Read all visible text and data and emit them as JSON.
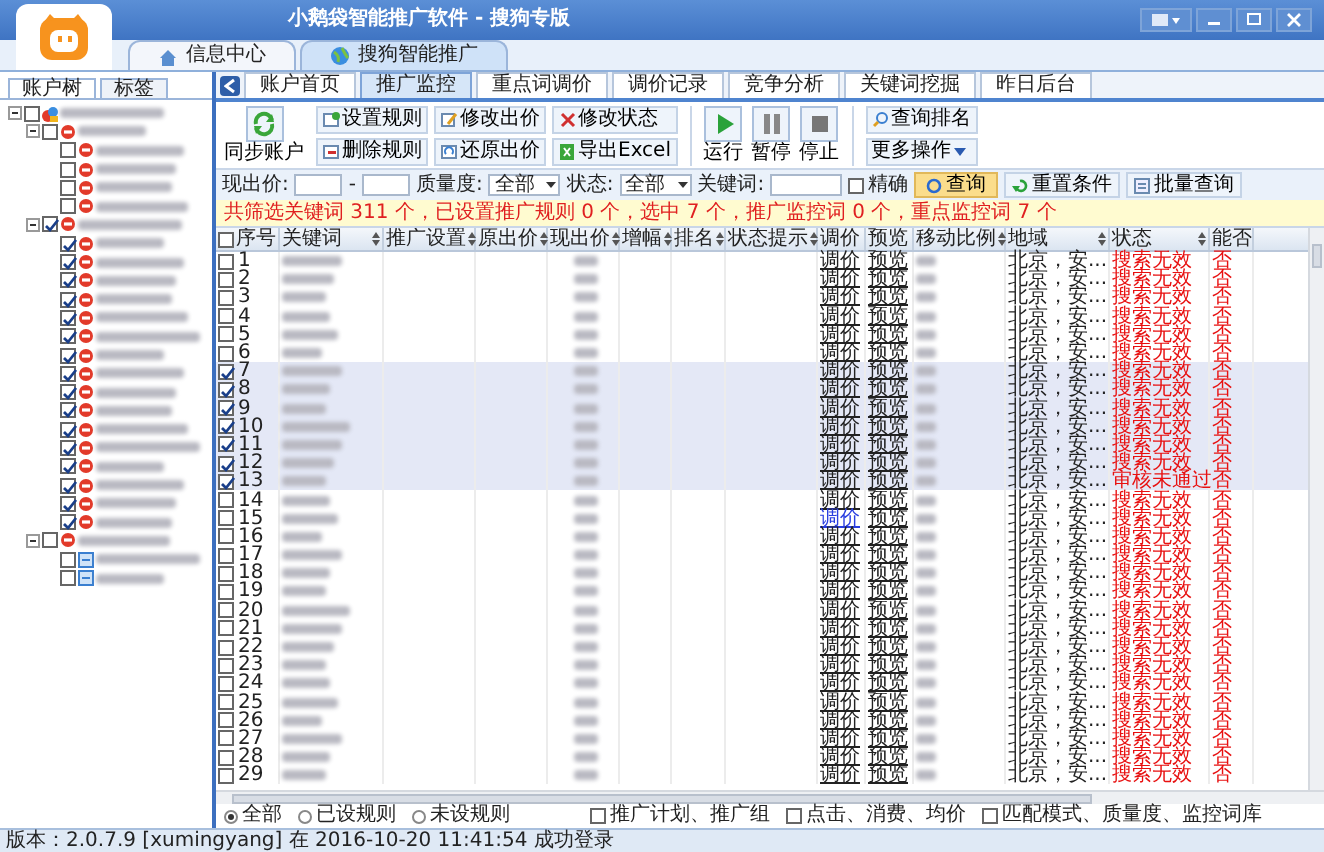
{
  "window": {
    "title": "小鹅袋智能推广软件 - 搜狗专版"
  },
  "app_tabs": [
    {
      "label": "信息中心",
      "kind": "home",
      "selected": false
    },
    {
      "label": "搜狗智能推广",
      "kind": "globe",
      "selected": true
    }
  ],
  "sidebar": {
    "tabs": [
      {
        "label": "账户树",
        "selected": true
      },
      {
        "label": "标签",
        "selected": false
      }
    ],
    "tree": [
      {
        "kind": "account",
        "checked": false,
        "expanded": true,
        "children": [
          {
            "kind": "plan",
            "checked": false,
            "expanded": true,
            "children": [
              {
                "kind": "unit",
                "checked": false
              },
              {
                "kind": "unit",
                "checked": false
              },
              {
                "kind": "unit",
                "checked": false
              },
              {
                "kind": "unit",
                "checked": false
              }
            ]
          },
          {
            "kind": "plan",
            "checked": true,
            "expanded": true,
            "children": [
              {
                "kind": "unit",
                "checked": true
              },
              {
                "kind": "unit",
                "checked": true
              },
              {
                "kind": "unit",
                "checked": true
              },
              {
                "kind": "unit",
                "checked": true
              },
              {
                "kind": "unit",
                "checked": true
              },
              {
                "kind": "unit",
                "checked": true
              },
              {
                "kind": "unit",
                "checked": true
              },
              {
                "kind": "unit",
                "checked": true
              },
              {
                "kind": "unit",
                "checked": true
              },
              {
                "kind": "unit",
                "checked": true
              },
              {
                "kind": "unit",
                "checked": true
              },
              {
                "kind": "unit",
                "checked": true
              },
              {
                "kind": "unit",
                "checked": true
              },
              {
                "kind": "unit",
                "checked": true
              },
              {
                "kind": "unit",
                "checked": true
              },
              {
                "kind": "unit",
                "checked": true
              }
            ]
          },
          {
            "kind": "plan",
            "checked": false,
            "expanded": true,
            "children": [
              {
                "kind": "group",
                "checked": false
              },
              {
                "kind": "group",
                "checked": false
              }
            ]
          }
        ]
      }
    ]
  },
  "tabs": [
    {
      "label": "账户首页",
      "selected": false
    },
    {
      "label": "推广监控",
      "selected": true
    },
    {
      "label": "重点词调价",
      "selected": false
    },
    {
      "label": "调价记录",
      "selected": false
    },
    {
      "label": "竞争分析",
      "selected": false
    },
    {
      "label": "关键词挖掘",
      "selected": false
    },
    {
      "label": "昨日后台",
      "selected": false
    }
  ],
  "toolbar": {
    "sync": "同步账户",
    "rule_buttons": [
      {
        "label": "设置规则",
        "kind": "set"
      },
      {
        "label": "修改出价",
        "kind": "edit"
      },
      {
        "label": "修改状态",
        "kind": "state"
      },
      {
        "label": "删除规则",
        "kind": "delete"
      },
      {
        "label": "还原出价",
        "kind": "restore"
      },
      {
        "label": "导出Excel",
        "kind": "excel"
      }
    ],
    "run_buttons": [
      {
        "label": "运行",
        "kind": "play"
      },
      {
        "label": "暂停",
        "kind": "pause"
      },
      {
        "label": "停止",
        "kind": "stop"
      }
    ],
    "rank_button": "查询排名",
    "more_button": "更多操作"
  },
  "filter": {
    "price_label": "现出价:",
    "range_sep": "-",
    "quality_label": "质量度:",
    "quality_value": "全部",
    "state_label": "状态:",
    "state_value": "全部",
    "keyword_label": "关键词:",
    "exact": {
      "label": "精确",
      "checked": false
    },
    "query": "查询",
    "reset": "重置条件",
    "batch": "批量查询"
  },
  "summary": "共筛选关键词 311 个，已设置推广规则 0 个，选中 7 个，推广监控词 0 个，重点监控词 7 个",
  "table": {
    "all_checked": false,
    "columns": [
      {
        "label": "序号",
        "sortable": false
      },
      {
        "label": "关键词",
        "sortable": true
      },
      {
        "label": "推广设置",
        "sortable": true
      },
      {
        "label": "原出价",
        "sortable": true
      },
      {
        "label": "现出价",
        "sortable": true
      },
      {
        "label": "增幅",
        "sortable": true
      },
      {
        "label": "排名",
        "sortable": true
      },
      {
        "label": "状态提示",
        "sortable": true
      },
      {
        "label": "调价",
        "sortable": false
      },
      {
        "label": "预览",
        "sortable": false
      },
      {
        "label": "移动比例",
        "sortable": true
      },
      {
        "label": "地域",
        "sortable": true
      },
      {
        "label": "状态",
        "sortable": true
      },
      {
        "label": "能否",
        "sortable": false
      }
    ],
    "rows": [
      {
        "no": "1",
        "checked": false,
        "adjust": "调价",
        "link_highlighted": false,
        "preview": "预览",
        "region": "北京，安...",
        "status": "搜索无效",
        "enabled": "否"
      },
      {
        "no": "2",
        "checked": false,
        "adjust": "调价",
        "link_highlighted": false,
        "preview": "预览",
        "region": "北京，安...",
        "status": "搜索无效",
        "enabled": "否"
      },
      {
        "no": "3",
        "checked": false,
        "adjust": "调价",
        "link_highlighted": false,
        "preview": "预览",
        "region": "北京，安...",
        "status": "搜索无效",
        "enabled": "否"
      },
      {
        "no": "4",
        "checked": false,
        "adjust": "调价",
        "link_highlighted": false,
        "preview": "预览",
        "region": "北京，安...",
        "status": "搜索无效",
        "enabled": "否"
      },
      {
        "no": "5",
        "checked": false,
        "adjust": "调价",
        "link_highlighted": false,
        "preview": "预览",
        "region": "北京，安...",
        "status": "搜索无效",
        "enabled": "否"
      },
      {
        "no": "6",
        "checked": false,
        "adjust": "调价",
        "link_highlighted": false,
        "preview": "预览",
        "region": "北京，安...",
        "status": "搜索无效",
        "enabled": "否"
      },
      {
        "no": "7",
        "checked": true,
        "adjust": "调价",
        "link_highlighted": false,
        "preview": "预览",
        "region": "北京，安...",
        "status": "搜索无效",
        "enabled": "否"
      },
      {
        "no": "8",
        "checked": true,
        "adjust": "调价",
        "link_highlighted": false,
        "preview": "预览",
        "region": "北京，安...",
        "status": "搜索无效",
        "enabled": "否"
      },
      {
        "no": "9",
        "checked": true,
        "adjust": "调价",
        "link_highlighted": false,
        "preview": "预览",
        "region": "北京，安...",
        "status": "搜索无效",
        "enabled": "否"
      },
      {
        "no": "10",
        "checked": true,
        "adjust": "调价",
        "link_highlighted": false,
        "preview": "预览",
        "region": "北京，安...",
        "status": "搜索无效",
        "enabled": "否"
      },
      {
        "no": "11",
        "checked": true,
        "adjust": "调价",
        "link_highlighted": false,
        "preview": "预览",
        "region": "北京，安...",
        "status": "搜索无效",
        "enabled": "否"
      },
      {
        "no": "12",
        "checked": true,
        "adjust": "调价",
        "link_highlighted": false,
        "preview": "预览",
        "region": "北京，安...",
        "status": "搜索无效",
        "enabled": "否"
      },
      {
        "no": "13",
        "checked": true,
        "adjust": "调价",
        "link_highlighted": false,
        "preview": "预览",
        "region": "北京，安...",
        "status": "审核未通过",
        "enabled": "否"
      },
      {
        "no": "14",
        "checked": false,
        "adjust": "调价",
        "link_highlighted": false,
        "preview": "预览",
        "region": "北京，安...",
        "status": "搜索无效",
        "enabled": "否"
      },
      {
        "no": "15",
        "checked": false,
        "adjust": "调价",
        "link_highlighted": true,
        "preview": "预览",
        "region": "北京，安...",
        "status": "搜索无效",
        "enabled": "否"
      },
      {
        "no": "16",
        "checked": false,
        "adjust": "调价",
        "link_highlighted": false,
        "preview": "预览",
        "region": "北京，安...",
        "status": "搜索无效",
        "enabled": "否"
      },
      {
        "no": "17",
        "checked": false,
        "adjust": "调价",
        "link_highlighted": false,
        "preview": "预览",
        "region": "北京，安...",
        "status": "搜索无效",
        "enabled": "否"
      },
      {
        "no": "18",
        "checked": false,
        "adjust": "调价",
        "link_highlighted": false,
        "preview": "预览",
        "region": "北京，安...",
        "status": "搜索无效",
        "enabled": "否"
      },
      {
        "no": "19",
        "checked": false,
        "adjust": "调价",
        "link_highlighted": false,
        "preview": "预览",
        "region": "北京，安...",
        "status": "搜索无效",
        "enabled": "否"
      },
      {
        "no": "20",
        "checked": false,
        "adjust": "调价",
        "link_highlighted": false,
        "preview": "预览",
        "region": "北京，安...",
        "status": "搜索无效",
        "enabled": "否"
      },
      {
        "no": "21",
        "checked": false,
        "adjust": "调价",
        "link_highlighted": false,
        "preview": "预览",
        "region": "北京，安...",
        "status": "搜索无效",
        "enabled": "否"
      },
      {
        "no": "22",
        "checked": false,
        "adjust": "调价",
        "link_highlighted": false,
        "preview": "预览",
        "region": "北京，安...",
        "status": "搜索无效",
        "enabled": "否"
      },
      {
        "no": "23",
        "checked": false,
        "adjust": "调价",
        "link_highlighted": false,
        "preview": "预览",
        "region": "北京，安...",
        "status": "搜索无效",
        "enabled": "否"
      },
      {
        "no": "24",
        "checked": false,
        "adjust": "调价",
        "link_highlighted": false,
        "preview": "预览",
        "region": "北京，安...",
        "status": "搜索无效",
        "enabled": "否"
      },
      {
        "no": "25",
        "checked": false,
        "adjust": "调价",
        "link_highlighted": false,
        "preview": "预览",
        "region": "北京，安...",
        "status": "搜索无效",
        "enabled": "否"
      },
      {
        "no": "26",
        "checked": false,
        "adjust": "调价",
        "link_highlighted": false,
        "preview": "预览",
        "region": "北京，安...",
        "status": "搜索无效",
        "enabled": "否"
      },
      {
        "no": "27",
        "checked": false,
        "adjust": "调价",
        "link_highlighted": false,
        "preview": "预览",
        "region": "北京，安...",
        "status": "搜索无效",
        "enabled": "否"
      },
      {
        "no": "28",
        "checked": false,
        "adjust": "调价",
        "link_highlighted": false,
        "preview": "预览",
        "region": "北京，安...",
        "status": "搜索无效",
        "enabled": "否"
      },
      {
        "no": "29",
        "checked": false,
        "adjust": "调价",
        "link_highlighted": false,
        "preview": "预览",
        "region": "北京，安...",
        "status": "搜索无效",
        "enabled": "否"
      }
    ]
  },
  "filter_options": {
    "radios": [
      {
        "label": "全部",
        "selected": true
      },
      {
        "label": "已设规则",
        "selected": false
      },
      {
        "label": "未设规则",
        "selected": false
      }
    ],
    "checkboxes": [
      {
        "label": "推广计划、推广组",
        "checked": false
      },
      {
        "label": "点击、消费、均价",
        "checked": false
      },
      {
        "label": "匹配模式、质量度、监控词库",
        "checked": false
      }
    ]
  },
  "status_bar": "版本：2.0.7.9 [xumingyang] 在 2016-10-20 11:41:54 成功登录"
}
